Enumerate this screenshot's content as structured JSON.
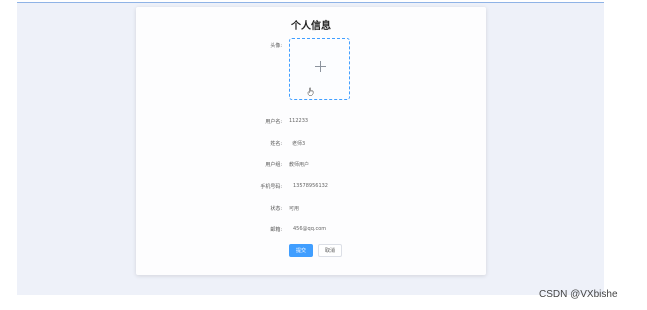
{
  "page": {
    "title": "个人信息"
  },
  "form": {
    "avatar_label": "头像:",
    "fields": [
      {
        "label": "用户名:",
        "value": "112233"
      },
      {
        "label": "姓名:",
        "value": "老师3"
      },
      {
        "label": "用户组:",
        "value": "教师用户"
      },
      {
        "label": "手机号码:",
        "value": "13578956132"
      },
      {
        "label": "状态:",
        "value": "可用"
      },
      {
        "label": "邮箱:",
        "value": "456@qq.com"
      }
    ],
    "submit_label": "提交",
    "cancel_label": "取消"
  },
  "watermark": "CSDN @VXbishe",
  "colors": {
    "primary": "#409eff",
    "background": "#eef1f9"
  }
}
